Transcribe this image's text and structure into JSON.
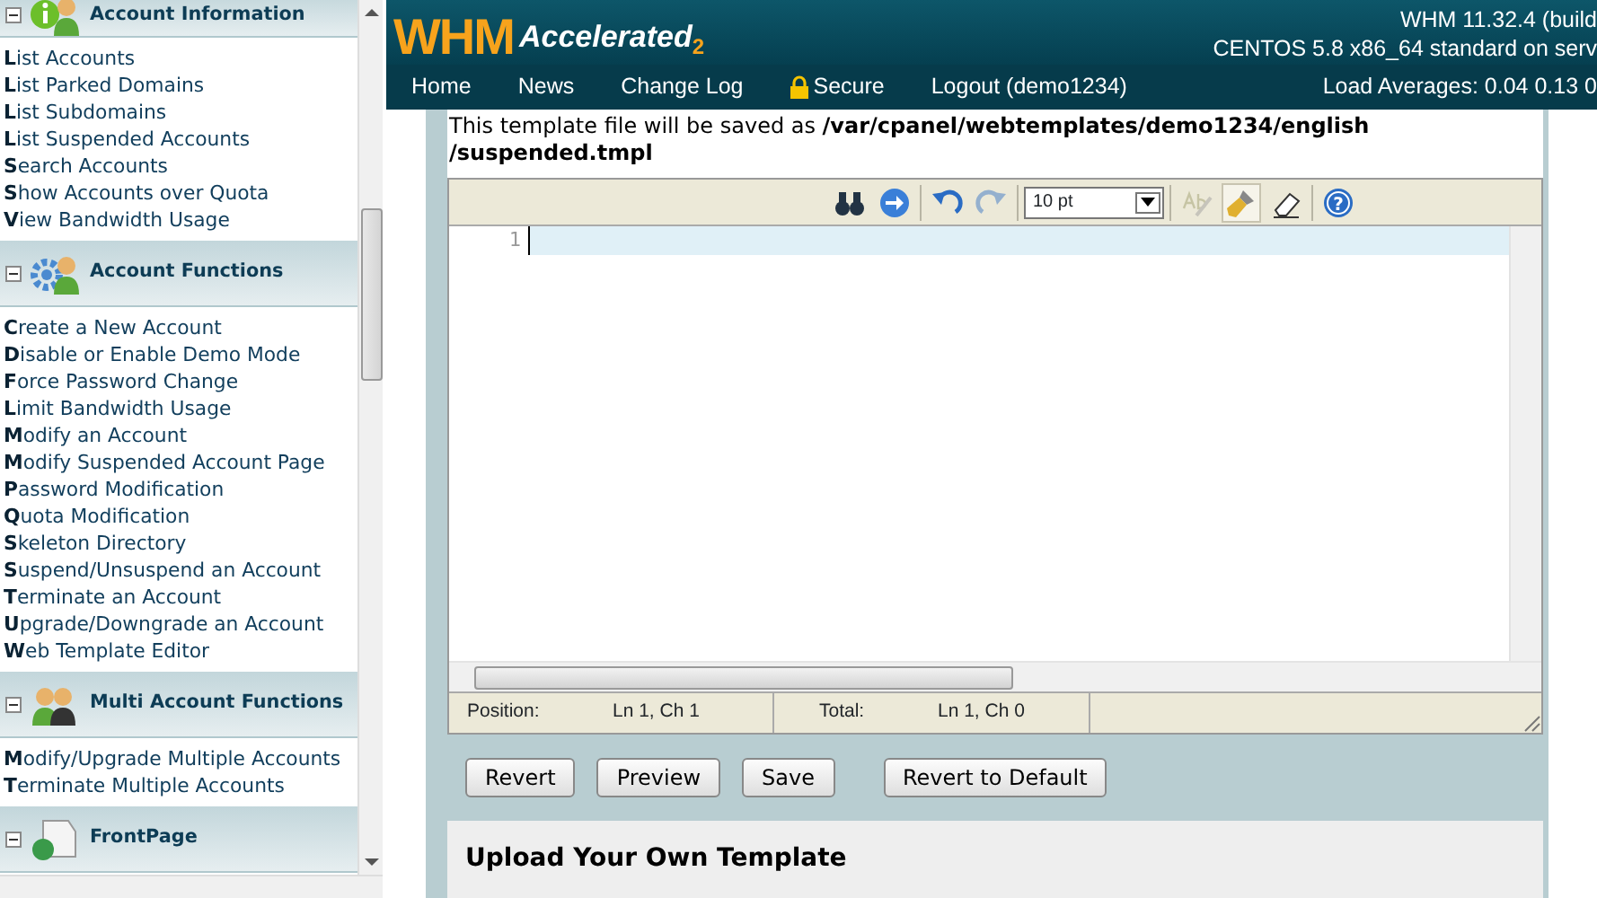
{
  "sidebar": {
    "sections": [
      {
        "title": "Account Information",
        "kind": "info",
        "expanded": true,
        "items": [
          "**L**ist Accounts",
          "**L**ist Parked Domains",
          "**L**ist Subdomains",
          "**L**ist Suspended Accounts",
          "**S**earch Accounts",
          "**S**how Accounts over Quota",
          "**V**iew Bandwidth Usage"
        ]
      },
      {
        "title": "Account Functions",
        "kind": "gear",
        "expanded": true,
        "items": [
          "**C**reate a New Account",
          "**D**isable or Enable Demo Mode",
          "**F**orce Password Change",
          "**L**imit Bandwidth Usage",
          "**M**odify an Account",
          "**M**odify Suspended Account Page",
          "**P**assword Modification",
          "**Q**uota Modification",
          "**S**keleton Directory",
          "**S**uspend/Unsuspend an Account",
          "**T**erminate an Account",
          "**U**pgrade/Downgrade an Account",
          "**W**eb Template Editor"
        ]
      },
      {
        "title": "Multi Account Functions",
        "kind": "people",
        "expanded": true,
        "items": [
          "**M**odify/Upgrade Multiple Accounts",
          "**T**erminate Multiple Accounts"
        ]
      },
      {
        "title": "FrontPage",
        "kind": "page",
        "expanded": true
      }
    ]
  },
  "header": {
    "logo": "WHM",
    "logo_tagline": "Accelerated",
    "logo_version": "2",
    "version": "WHM 11.32.4 (build",
    "os": "CENTOS 5.8 x86_64 standard on serv"
  },
  "nav": {
    "items": [
      {
        "label": "Home",
        "kind": "link"
      },
      {
        "label": "News",
        "kind": "link"
      },
      {
        "label": "Change Log",
        "kind": "link"
      },
      {
        "label": "Secure",
        "kind": "lock"
      },
      {
        "label": "Logout (demo1234)",
        "kind": "link"
      }
    ],
    "load": "Load Averages: 0.04 0.13 0"
  },
  "intro": "This template file will be saved as **/var/cpanel/webtemplates/demo1234/english /suspended.tmpl**",
  "editor": {
    "toolbar": [
      {
        "kind": "find",
        "disabled": false,
        "pressed": false
      },
      {
        "kind": "goto",
        "disabled": false,
        "pressed": false
      },
      {
        "kind": "sep"
      },
      {
        "kind": "undo",
        "disabled": false,
        "pressed": false
      },
      {
        "kind": "redo",
        "disabled": true,
        "pressed": false
      },
      {
        "kind": "sep"
      },
      {
        "kind": "select",
        "value": "10 pt"
      },
      {
        "kind": "sep"
      },
      {
        "kind": "spell",
        "disabled": true,
        "pressed": false
      },
      {
        "kind": "highlight",
        "disabled": false,
        "pressed": true
      },
      {
        "kind": "reset",
        "disabled": false,
        "pressed": false
      },
      {
        "kind": "sep"
      },
      {
        "kind": "help",
        "label": "?",
        "disabled": false,
        "pressed": false
      }
    ],
    "line_numbers": [
      "1"
    ],
    "status": {
      "position_label": "Position:",
      "position": "Ln 1, Ch 1",
      "total_label": "Total:",
      "total": "Ln 1, Ch 0"
    }
  },
  "buttons": [
    "Revert",
    "Preview",
    "Save",
    "Revert to Default"
  ],
  "upload_title": "Upload Your Own Template"
}
